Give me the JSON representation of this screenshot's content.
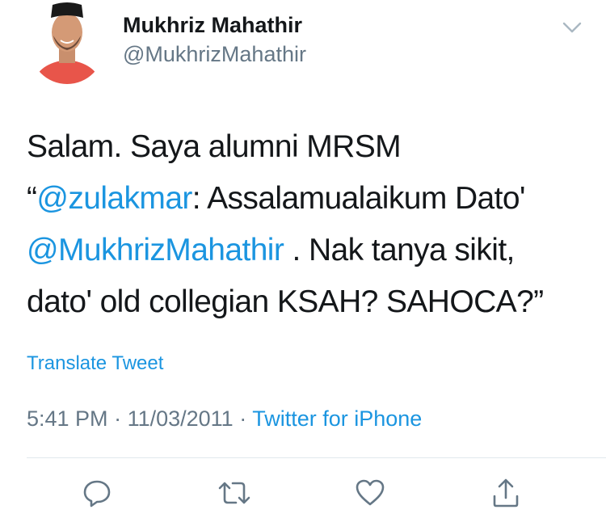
{
  "user": {
    "display_name": "Mukhriz Mahathir",
    "handle": "@MukhrizMahathir"
  },
  "tweet": {
    "line1": "Salam. Saya alumni MRSM",
    "line2_open_quote": "“",
    "line2_mention": "@zulakmar",
    "line2_rest": ": Assalamualaikum Dato'",
    "line3_mention": "@MukhrizMahathir",
    "line3_rest": " . Nak tanya sikit,",
    "line4": "dato' old collegian KSAH? SAHOCA?”"
  },
  "translate_label": "Translate Tweet",
  "meta": {
    "time": "5:41 PM",
    "separator": " · ",
    "date": "11/03/2011",
    "separator2": " · ",
    "source": "Twitter for iPhone"
  },
  "icons": {
    "caret": "chevron-down-icon",
    "reply": "reply-icon",
    "retweet": "retweet-icon",
    "like": "heart-icon",
    "share": "share-icon"
  },
  "colors": {
    "link": "#1b95e0",
    "secondary": "#657786",
    "text": "#14171a"
  }
}
